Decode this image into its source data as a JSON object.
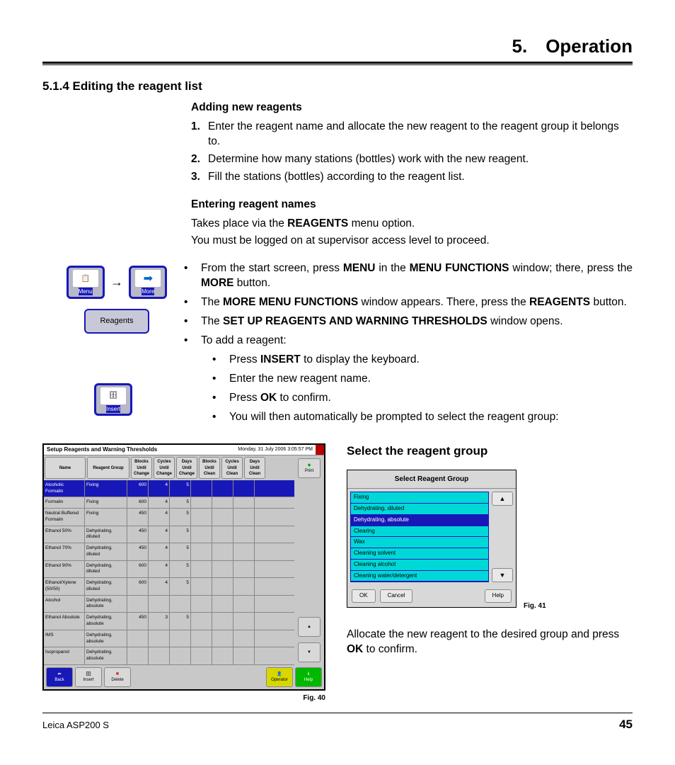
{
  "chapter": "5. Operation",
  "section": "5.1.4 Editing the reagent list",
  "sub1": "Adding new reagents",
  "ol": [
    "Enter the reagent name and allocate the new reagent to the reagent group it belongs to.",
    "Determine how many stations (bottles) work with the new reagent.",
    "Fill the stations (bottles) according to the reagent list."
  ],
  "sub2": "Entering reagent names",
  "p1a": "Takes place via the ",
  "p1b": "REAGENTS",
  "p1c": " menu option.",
  "p2": "You must be logged on at supervisor access level to proceed.",
  "b1": {
    "a": "From the start screen, press ",
    "b": "MENU",
    "c": " in the ",
    "d": "MENU FUNCTIONS",
    "e": " window; there, press the ",
    "f": "MORE",
    "g": " button."
  },
  "b2": {
    "a": "The ",
    "b": "MORE MENU FUNCTIONS",
    "c": " window appears. There, press the ",
    "d": "REAGENTS",
    "e": " button."
  },
  "b3": {
    "a": "The ",
    "b": "SET UP REAGENTS AND WARNING THRESHOLDS",
    "c": " window opens."
  },
  "b4": "To add a reagent:",
  "n1": {
    "a": "Press ",
    "b": "INSERT",
    "c": " to display the keyboard."
  },
  "n2": "Enter the new reagent name.",
  "n3": {
    "a": "Press ",
    "b": "OK",
    "c": " to confirm."
  },
  "n4": "You will then automatically be prompted to select the reagent group:",
  "btns": {
    "menu": "Menu",
    "more": "More",
    "reagents": "Reagents",
    "insert": "Insert"
  },
  "fig40": {
    "title": "Setup Reagents and Warning Thresholds",
    "date": "Monday, 31 July 2006 3:05:57 PM",
    "hdr": [
      "Name",
      "Reagent Group",
      "Blocks Until Change",
      "Cycles Until Change",
      "Days Until Change",
      "Blocks Until Clean",
      "Cycles Until Clean",
      "Days Until Clean"
    ],
    "rows": [
      {
        "n": "Alcoholic Formalin",
        "g": "Fixing",
        "v": [
          "600",
          "4",
          "5",
          "",
          "",
          ""
        ],
        "sel": true
      },
      {
        "n": "Formalin",
        "g": "Fixing",
        "v": [
          "600",
          "4",
          "5",
          "",
          "",
          ""
        ]
      },
      {
        "n": "Neutral Buffered Formalin",
        "g": "Fixing",
        "v": [
          "450",
          "4",
          "5",
          "",
          "",
          ""
        ]
      },
      {
        "n": "Ethanol 50%",
        "g": "Dehydrating, diluted",
        "v": [
          "450",
          "4",
          "5",
          "",
          "",
          ""
        ]
      },
      {
        "n": "Ethanol 70%",
        "g": "Dehydrating, diluted",
        "v": [
          "450",
          "4",
          "5",
          "",
          "",
          ""
        ]
      },
      {
        "n": "Ethanol 90%",
        "g": "Dehydrating, diluted",
        "v": [
          "600",
          "4",
          "5",
          "",
          "",
          ""
        ]
      },
      {
        "n": "Ethanol/Xylene (50/50)",
        "g": "Dehydrating, diluted",
        "v": [
          "600",
          "4",
          "5",
          "",
          "",
          ""
        ]
      },
      {
        "n": "Alcohol",
        "g": "Dehydrating, absolute",
        "v": [
          "",
          "",
          "",
          "",
          "",
          ""
        ]
      },
      {
        "n": "Ethanol Absolute",
        "g": "Dehydrating, absolute",
        "v": [
          "450",
          "3",
          "5",
          "",
          "",
          ""
        ]
      },
      {
        "n": "IMS",
        "g": "Dehydrating, absolute",
        "v": [
          "",
          "",
          "",
          "",
          "",
          ""
        ]
      },
      {
        "n": "Isopropanol",
        "g": "Dehydrating, absolute",
        "v": [
          "",
          "",
          "",
          "",
          "",
          ""
        ]
      }
    ],
    "side": {
      "print": "Print"
    },
    "foot": [
      "Back",
      "Insert",
      "Delete",
      "Operator",
      "Help"
    ],
    "cap": "Fig. 40"
  },
  "fig41": {
    "head": "Select the reagent group",
    "title": "Select Reagent Group",
    "items": [
      {
        "t": "Fixing"
      },
      {
        "t": "Dehydrating, diluted"
      },
      {
        "t": "Dehydrating, absolute",
        "sel": true
      },
      {
        "t": "Clearing"
      },
      {
        "t": "Wax"
      },
      {
        "t": "Cleaning solvent"
      },
      {
        "t": "Cleaning alcohol"
      },
      {
        "t": "Cleaning water/detergent"
      }
    ],
    "btns": {
      "ok": "OK",
      "cancel": "Cancel",
      "help": "Help"
    },
    "cap": "Fig. 41"
  },
  "p3": {
    "a": "Allocate the new reagent to the desired group and press ",
    "b": "OK",
    "c": " to confirm."
  },
  "footer": {
    "product": "Leica ASP200 S",
    "page": "45"
  }
}
